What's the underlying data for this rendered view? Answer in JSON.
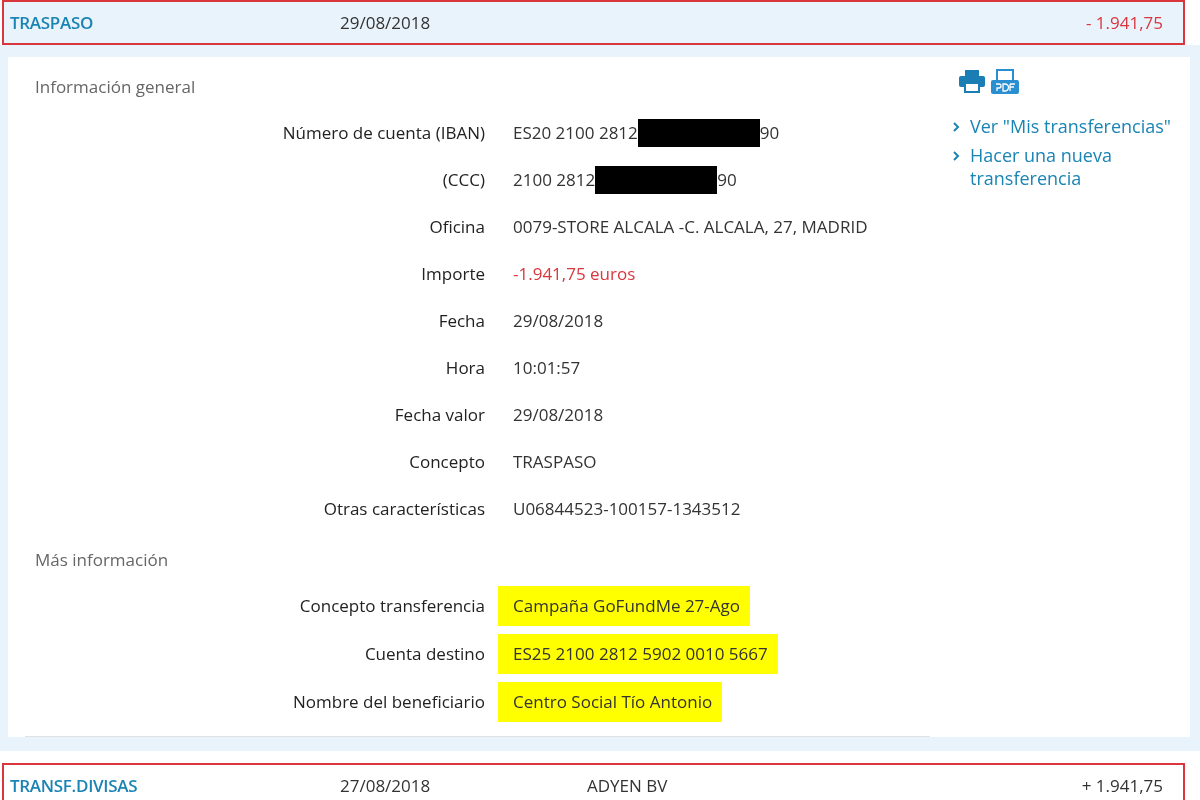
{
  "movements": [
    {
      "title": "TRASPASO",
      "date": "29/08/2018",
      "amount": "- 1.941,75",
      "negative": true,
      "expanded": true
    },
    {
      "title": "TRANSF.DIVISAS",
      "date": "27/08/2018",
      "description": "ADYEN BV",
      "amount": "+ 1.941,75",
      "negative": false,
      "expanded": false
    }
  ],
  "detail": {
    "sections": [
      {
        "title": "Información general",
        "fields": [
          {
            "label": "Número de cuenta (IBAN)",
            "kind": "redacted",
            "value": "ES20 2100 2812",
            "value_end": "90",
            "highlighted": false
          },
          {
            "label": "(CCC)",
            "kind": "redacted",
            "value": "2100 2812",
            "value_end": "90",
            "highlighted": false
          },
          {
            "label": "Oficina",
            "kind": "text",
            "value": "0079-STORE ALCALA -C. ALCALA, 27, MADRID",
            "highlighted": false
          },
          {
            "label": "Importe",
            "kind": "negative",
            "value": "-1.941,75 euros",
            "highlighted": false
          },
          {
            "label": "Fecha",
            "kind": "text",
            "value": "29/08/2018",
            "highlighted": false
          },
          {
            "label": "Hora",
            "kind": "text",
            "value": "10:01:57",
            "highlighted": false
          },
          {
            "label": "Fecha valor",
            "kind": "text",
            "value": "29/08/2018",
            "highlighted": false
          },
          {
            "label": "Concepto",
            "kind": "text",
            "value": "TRASPASO",
            "highlighted": false
          },
          {
            "label": "Otras características",
            "kind": "text",
            "value": "U06844523-100157-1343512",
            "highlighted": false
          }
        ]
      },
      {
        "title": "Más información",
        "fields": [
          {
            "label": "Concepto transferencia",
            "kind": "text",
            "value": "Campaña GoFundMe 27-Ago",
            "highlighted": true
          },
          {
            "label": "Cuenta destino",
            "kind": "text",
            "value": "ES25 2100 2812 5902 0010 5667",
            "highlighted": true
          },
          {
            "label": "Nombre del beneficiario",
            "kind": "text",
            "value": "Centro Social Tío Antonio",
            "highlighted": true
          }
        ]
      }
    ],
    "links": [
      "Ver \"Mis transferencias\"",
      "Hacer una nueva transferencia"
    ]
  }
}
